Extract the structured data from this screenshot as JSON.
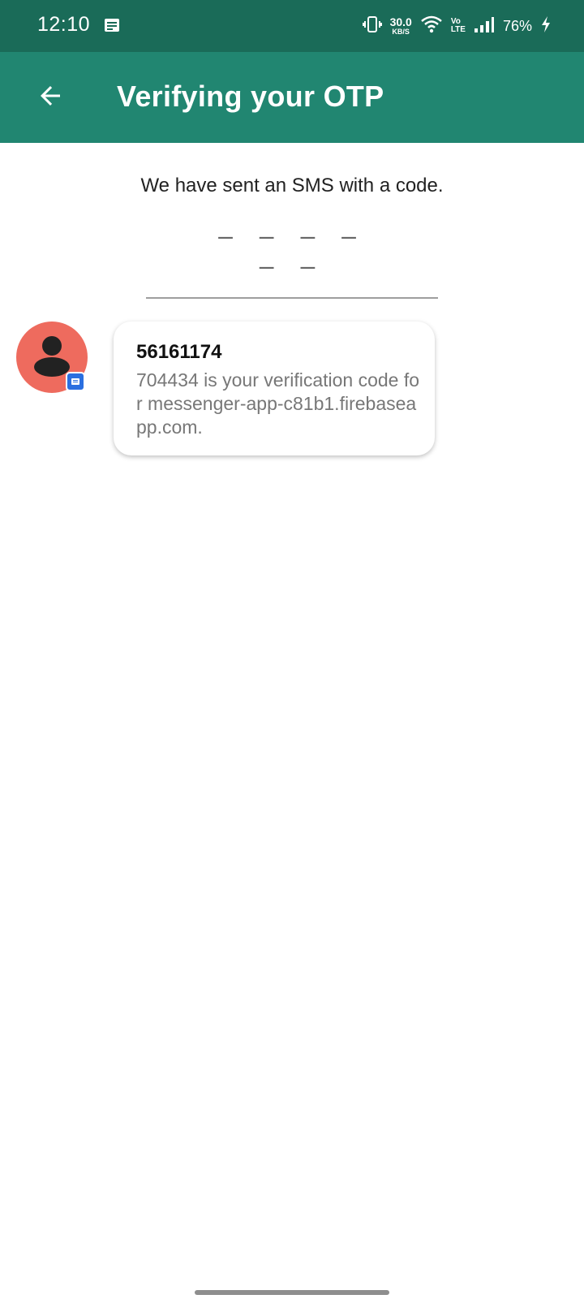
{
  "status_bar": {
    "time": "12:10",
    "net_speed": "30.0",
    "net_speed_unit": "KB/S",
    "volte_top": "Vo",
    "volte_bottom": "LTE",
    "battery": "76%"
  },
  "app_bar": {
    "title": "Verifying your OTP"
  },
  "otp": {
    "instruction": "We have sent an SMS with a code.",
    "placeholder": "– – – – – –"
  },
  "sms_suggestion": {
    "sender": "56161174",
    "message": "704434 is your verification code for messenger-app-c81b1.firebaseapp.com."
  },
  "colors": {
    "status_bar": "#1a6b58",
    "app_bar": "#218671",
    "avatar": "#ee6b5e",
    "badge": "#2a6fe0"
  }
}
